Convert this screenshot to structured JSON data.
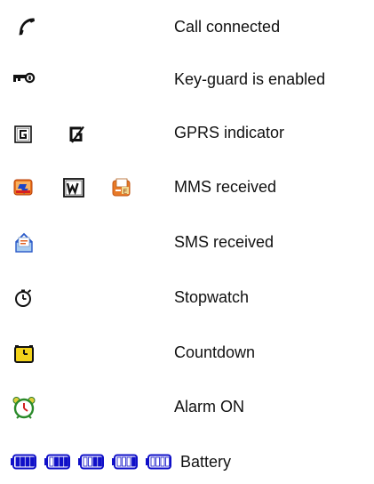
{
  "legend": {
    "items": [
      {
        "icons": [
          "phone-handset-icon"
        ],
        "label": "Call connected"
      },
      {
        "icons": [
          "key-icon"
        ],
        "label": "Key-guard is enabled"
      },
      {
        "icons": [
          "gprs-g-icon",
          "gprs-suspended-icon"
        ],
        "label": "GPRS indicator"
      },
      {
        "icons": [
          "mms-envelope-icon",
          "wap-w-icon",
          "mms-message-icon"
        ],
        "label": "MMS received"
      },
      {
        "icons": [
          "sms-envelope-icon"
        ],
        "label": "SMS received"
      },
      {
        "icons": [
          "stopwatch-icon"
        ],
        "label": "Stopwatch"
      },
      {
        "icons": [
          "countdown-timer-icon"
        ],
        "label": "Countdown"
      },
      {
        "icons": [
          "alarm-clock-icon"
        ],
        "label": "Alarm ON"
      }
    ],
    "battery": {
      "label": "Battery",
      "levels": [
        1.0,
        0.75,
        0.5,
        0.25,
        0.0
      ],
      "color": "#1010c8"
    }
  }
}
